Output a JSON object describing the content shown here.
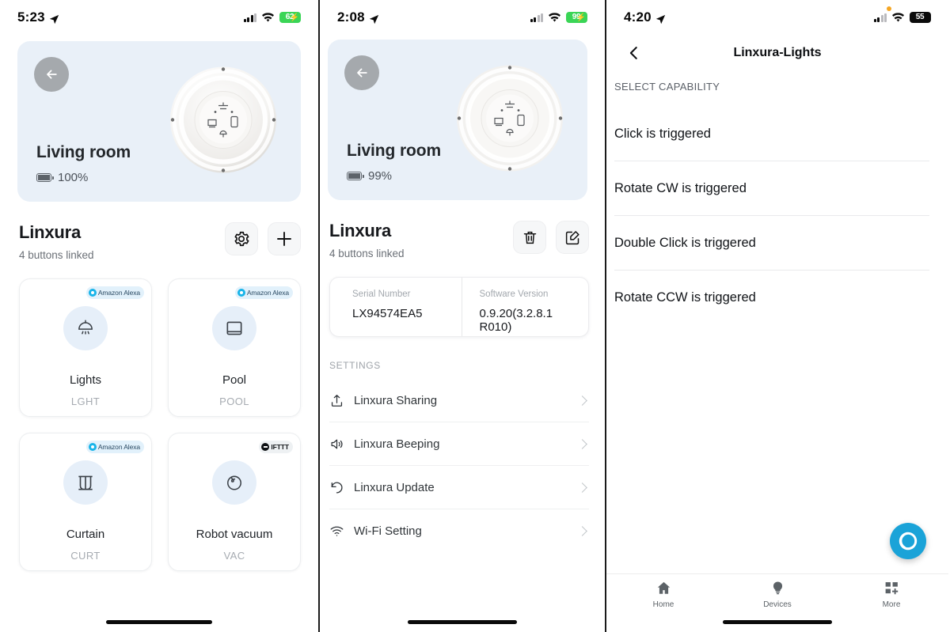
{
  "panels": [
    {
      "status": {
        "time": "5:23",
        "battery": "62",
        "battery_style": "green",
        "location_icon": "location-arrow-icon",
        "wifi_icon": "wifi-icon",
        "cellular_icon": "cellular-bars-icon"
      },
      "hero": {
        "back_icon": "back-arrow-icon",
        "title": "Living room",
        "battery_text": "100%",
        "battery_icon": "battery-icon",
        "device_icon": "linxura-controller-image"
      },
      "section": {
        "title": "Linxura",
        "subtitle": "4 buttons linked",
        "settings_icon": "gear-icon",
        "add_icon": "plus-icon"
      },
      "cards": [
        {
          "badge": "Amazon Alexa",
          "badge_type": "alexa",
          "icon": "ceiling-lamp-icon",
          "name": "Lights",
          "code": "LGHT"
        },
        {
          "badge": "Amazon Alexa",
          "badge_type": "alexa",
          "icon": "window-icon",
          "name": "Pool",
          "code": "POOL"
        },
        {
          "badge": "Amazon Alexa",
          "badge_type": "alexa",
          "icon": "curtain-icon",
          "name": "Curtain",
          "code": "CURT"
        },
        {
          "badge": "IFTTT",
          "badge_type": "ifttt",
          "icon": "robot-vacuum-icon",
          "name": "Robot vacuum",
          "code": "VAC"
        }
      ]
    },
    {
      "status": {
        "time": "2:08",
        "battery": "99",
        "battery_style": "green"
      },
      "hero": {
        "title": "Living room",
        "battery_text": "99%"
      },
      "section": {
        "title": "Linxura",
        "subtitle": "4 buttons linked",
        "delete_icon": "trash-icon",
        "edit_icon": "edit-square-icon"
      },
      "info": [
        {
          "label": "Serial Number",
          "value": "LX94574EA5"
        },
        {
          "label": "Software Version",
          "value": "0.9.20(3.2.8.1 R010)"
        }
      ],
      "settings_label": "SETTINGS",
      "settings": [
        {
          "icon": "share-upload-icon",
          "label": "Linxura Sharing"
        },
        {
          "icon": "speaker-volume-icon",
          "label": "Linxura Beeping"
        },
        {
          "icon": "refresh-counterclockwise-icon",
          "label": "Linxura Update"
        },
        {
          "icon": "wifi-icon",
          "label": "Wi-Fi Setting"
        }
      ]
    },
    {
      "status": {
        "time": "4:20",
        "battery": "55",
        "battery_style": "dark"
      },
      "nav": {
        "back_icon": "chevron-left-icon",
        "title": "Linxura-Lights"
      },
      "capability_label": "SELECT CAPABILITY",
      "capabilities": [
        "Click is triggered",
        "Rotate CW is triggered",
        "Double Click is triggered",
        "Rotate CCW is triggered"
      ],
      "fab": {
        "icon": "alexa-icon"
      },
      "tabs": [
        {
          "icon": "home-icon",
          "label": "Home"
        },
        {
          "icon": "bulb-icon",
          "label": "Devices"
        },
        {
          "icon": "more-grid-icon",
          "label": "More"
        }
      ]
    }
  ],
  "colors": {
    "accent_blue": "#1aa3d8",
    "hero_bg": "#e9f0f8",
    "alexa_cyan": "#18b4e9",
    "battery_green": "#3ad556"
  }
}
